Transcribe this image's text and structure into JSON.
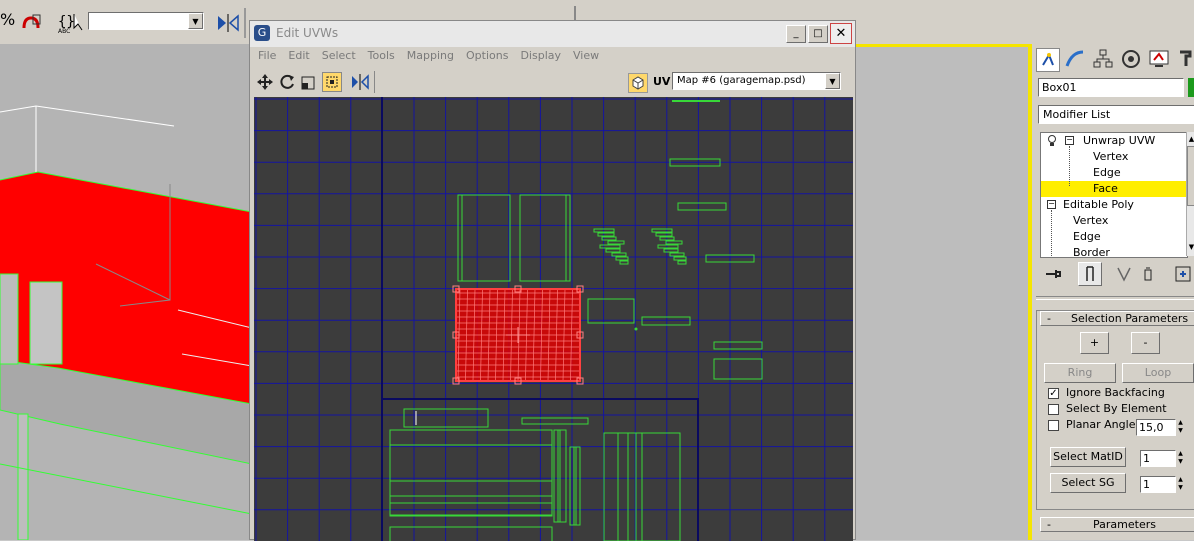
{
  "main_toolbar": {
    "percent_label": "%",
    "abc_label": "ABC",
    "named_selection_value": ""
  },
  "editor": {
    "title": "Edit UVWs",
    "menu": [
      "File",
      "Edit",
      "Select",
      "Tools",
      "Mapping",
      "Options",
      "Display",
      "View"
    ],
    "uv_label": "UV",
    "map_dropdown_value": "Map #6 (garagemap.psd)"
  },
  "command_panel": {
    "object_name": "Box01",
    "modifier_list_label": "Modifier List",
    "stack": [
      {
        "label": "Unwrap UVW",
        "level": 0
      },
      {
        "label": "Vertex",
        "level": 1
      },
      {
        "label": "Edge",
        "level": 1
      },
      {
        "label": "Face",
        "level": 1,
        "selected": true
      },
      {
        "label": "Editable Poly",
        "level": 0
      },
      {
        "label": "Vertex",
        "level": 1
      },
      {
        "label": "Edge",
        "level": 1
      },
      {
        "label": "Border",
        "level": 1
      }
    ],
    "selection_parameters": {
      "title": "Selection Parameters",
      "collapse": "-",
      "grow_label": "+",
      "shrink_label": "-",
      "ring_label": "Ring",
      "loop_label": "Loop",
      "ignore_backfacing_label": "Ignore Backfacing",
      "ignore_backfacing_checked": true,
      "select_by_element_label": "Select By Element",
      "planar_angle_label": "Planar Angle",
      "planar_angle_value": "15,0",
      "select_matid_label": "Select MatID",
      "matid_value": "1",
      "select_sg_label": "Select SG",
      "sg_value": "1"
    },
    "parameters": {
      "title": "Parameters",
      "collapse": "-"
    }
  },
  "colors": {
    "uv_grid_background": "#3c3c3c",
    "grid_lines": "#1414a0",
    "uv_wire": "#38d838",
    "selection": "#e00000",
    "selected_highlight": "#ffee00"
  }
}
